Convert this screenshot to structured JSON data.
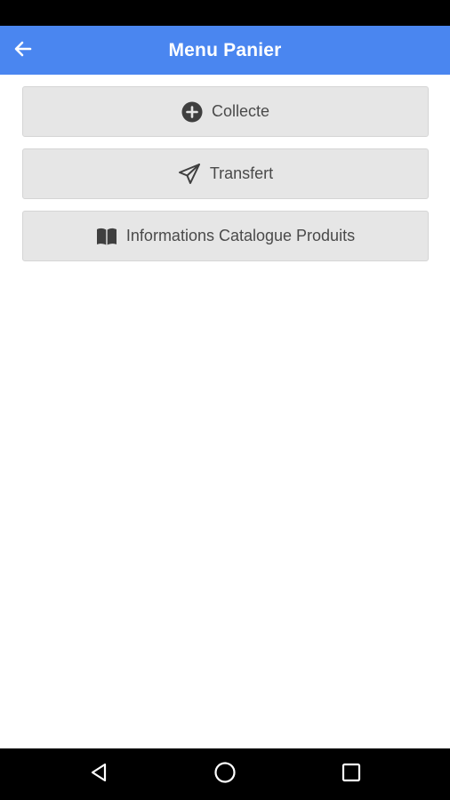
{
  "app_bar": {
    "title": "Menu Panier",
    "back_icon": "arrow-left-icon",
    "color": "#4a86f0"
  },
  "menu": {
    "items": [
      {
        "label": "Collecte",
        "icon": "plus-circle-icon"
      },
      {
        "label": "Transfert",
        "icon": "paper-plane-icon"
      },
      {
        "label": "Informations Catalogue Produits",
        "icon": "book-open-icon"
      }
    ]
  },
  "system_nav": {
    "back_icon": "nav-back-icon",
    "home_icon": "nav-home-icon",
    "recents_icon": "nav-recents-icon"
  }
}
